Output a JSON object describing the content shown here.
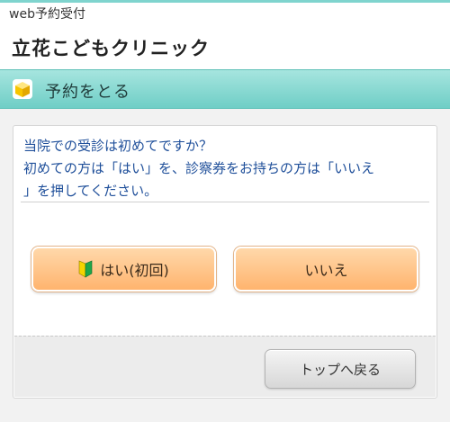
{
  "header": {
    "web_label": "web予約受付",
    "clinic_name": "立花こどもクリニック"
  },
  "section": {
    "icon": "cube-icon",
    "title": "予約をとる"
  },
  "question": {
    "lines": [
      "当院での受診は初めてですか？",
      "初めての方は「はい」を、診察券をお持ちの方は「いいえ",
      "」を押してください。"
    ]
  },
  "buttons": {
    "yes_label": "はい(初回)",
    "yes_icon": "beginner-leaf-icon",
    "no_label": "いいえ",
    "top_label": "トップへ戻る"
  },
  "colors": {
    "accent_teal": "#6fcec6",
    "question_text": "#1f4f9a",
    "button_orange": "#ffb46e"
  }
}
